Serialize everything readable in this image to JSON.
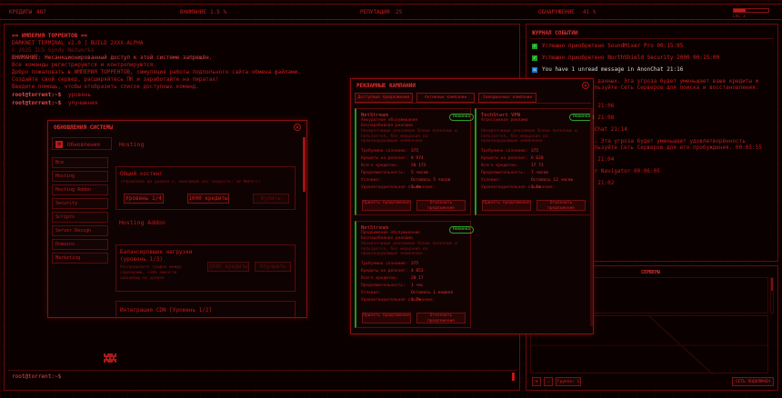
{
  "topbar": {
    "credits_label": "КРЕДИТЫ",
    "credits_value": "487",
    "fame_label": "ВНИМАНИЕ",
    "fame_value": "1.5 %",
    "reputation_label": "РЕПУТАЦИЯ",
    "reputation_value": "25",
    "detection_label": "ОБНАРУЖЕНИЕ",
    "detection_value": "41 %",
    "lvl_label": "LVL 3",
    "lvl_progress": 0.35
  },
  "terminal": {
    "title": "== ИМПЕРИЯ ТОРРЕНТОВ ==",
    "lines": [
      "DARKNET TERMINAL v2.0 | BUILD 2XXX-ALPHA",
      "© 2025 ILS Syndy Networks",
      "ВНИМАНИЕ: Несанкционированный доступ к этой системе запрещён.",
      "Все команды регистрируются и контролируются.",
      "Добро пожаловать в ИМПЕРИЯ ТОРРЕНТОВ, симуляция работы подпольного сайта обмена файлами.",
      "Создайте свой сервер, расширяйтесь ПК и заработайте на пиратах!",
      "Введите помощь, чтобы отобразить список доступных команд."
    ],
    "prompt1": "root@torrent:~$",
    "cmd1": "уровень",
    "prompt2": "root@torrent:~$",
    "cmd2": "улучшения",
    "prompt_bottom": "root@torrent:~$"
  },
  "upgrades_window": {
    "title": "ОБНОВЛЕНИЯ СИСТЕМЫ",
    "header": "Обновления",
    "side_items": [
      "Все",
      "Hosting",
      "Hosting Addon",
      "Security",
      "Scripts",
      "Server Design",
      "Domains",
      "Marketing"
    ],
    "section1": "Hosting",
    "item1_title": "Общий хостинг",
    "item1_desc": "(Управлено до уровня 2, максимум 265 скорость: 10 MBPS/c)",
    "item1_btn1": "Уровень 1/4",
    "item1_btn2": "1000 кредиты",
    "item1_btn3": "Купить",
    "section2": "Hosting Addon",
    "item2_title": "Балансировщик нагрузки",
    "item2_sub": "(уровень 1/3)",
    "item2_desc": "Распределите трафик между серверами, +10% емкости хранилищ на уровне",
    "item2_btn1": "1000 кредиты",
    "item2_btn2": "Улучшить",
    "item3_title": "Интеграция CDN [Уровень 1/2]"
  },
  "campaigns_window": {
    "title": "РЕКЛАМНЫЕ КАМПАНИИ",
    "tabs": [
      "Доступные предложения",
      "Активные кампании",
      "Завершенные кампании"
    ],
    "cards": [
      {
        "title": "NetStream",
        "subtitle": "Аккуратное обслуживание Бесперебойная реклама",
        "badge": "Новинка",
        "desc": "Ненавязчивые рекламные блоки полезные и пользуется, без мерцания на правонарушающие изменения.",
        "rows": [
          [
            "Требуемое сознание:",
            "375"
          ],
          [
            "Кредиты на депозит:",
            "8 974"
          ],
          [
            "Всего кредитов:",
            "20 173"
          ],
          [
            "Продолжительность:",
            "5 часов"
          ],
          [
            "Условия:",
            "Осталось 5 часов"
          ],
          [
            "Удовлетворительное отклонение:",
            "1.4%"
          ]
        ],
        "btn1": "Принять предложение",
        "btn2": "Отклонить предложение"
      },
      {
        "title": "TechStart VPN",
        "subtitle": "Агрессивная реклама",
        "badge": "Новинка",
        "desc": "Ненавязчивые рекламные блоки полезные и пользуется, без мерцания на правонарушающие изменения.",
        "rows": [
          [
            "Требуемое сознание:",
            "375"
          ],
          [
            "Кредиты на депозит:",
            "6 620"
          ],
          [
            "Всего кредитов:",
            "17 73"
          ],
          [
            "Продолжительность:",
            "7 часов"
          ],
          [
            "Условия:",
            "Осталось 12 часов"
          ],
          [
            "Удовлетворительное отклонение:",
            "1.1%"
          ]
        ],
        "btn1": "Принять предложение",
        "btn2": "Отклонить предложение"
      },
      {
        "title": "NetStream",
        "subtitle": "Продвижение обслуживание Бесперебойная реклама",
        "badge": "Новинка",
        "desc": "Ненавязчивые рекламные блоки полезные и пользуется, без мерцания на правонарушающие изменения.",
        "rows": [
          [
            "Требуемое сознание:",
            "375"
          ],
          [
            "Кредиты на депозит:",
            "4 853"
          ],
          [
            "Всего кредитов:",
            "20 17"
          ],
          [
            "Продолжительность:",
            "1 час"
          ],
          [
            "Условия:",
            "Осталось 1 неделя"
          ],
          [
            "Удовлетворительное отклонение:",
            "1.7%"
          ]
        ],
        "btn1": "Принять предложение",
        "btn2": "Отклонить предложение"
      }
    ]
  },
  "events": {
    "title": "ЖУРНАЛ СОБЫТИЙ",
    "items": [
      {
        "text": "Успешно приобретено SoundMixer Pro 00:15:05",
        "kind": "green"
      },
      {
        "text": "Успешно приобретено NorthShield Security 2000 00:15:00",
        "kind": "green"
      },
      {
        "text": "You have 1 unread message in AnonChat 21:16",
        "kind": "blue"
      },
      {
        "text": "Новая задача Утечка данных. Эта угроза будет уменьшает ваше кредиты и нейтрализация. Используйте Сеть Серверов для поиска и восстановления. 00:05:35",
        "kind": "red"
      },
      {
        "text": "message in AnonChat 21:06",
        "kind": "red"
      },
      {
        "text": "message in AnonChat 21:08",
        "kind": "red"
      },
      {
        "text": "new mission in AnonChat 21:14",
        "kind": "red"
      },
      {
        "text": "Новая задача Утечка. Эта угроза будет уменьшает удовлетворённость нейтрализация. Используйте Сеть Серверов для его пробуждения. 00:05:55",
        "kind": "red"
      },
      {
        "text": "message in AnonChat 21:04",
        "kind": "red"
      },
      {
        "text": "приобретено Wanderer Navigator 00:06:05",
        "kind": "red"
      },
      {
        "text": "message in AnonChat 21:02",
        "kind": "red"
      }
    ]
  },
  "network": {
    "title": "СЕРВЕРЫ",
    "zoom_label": "Группа: 1",
    "btn_plus": "+",
    "btn_minus": "-",
    "btn_more": "СЕТЬ ПОДКЛЮЧЕН"
  }
}
